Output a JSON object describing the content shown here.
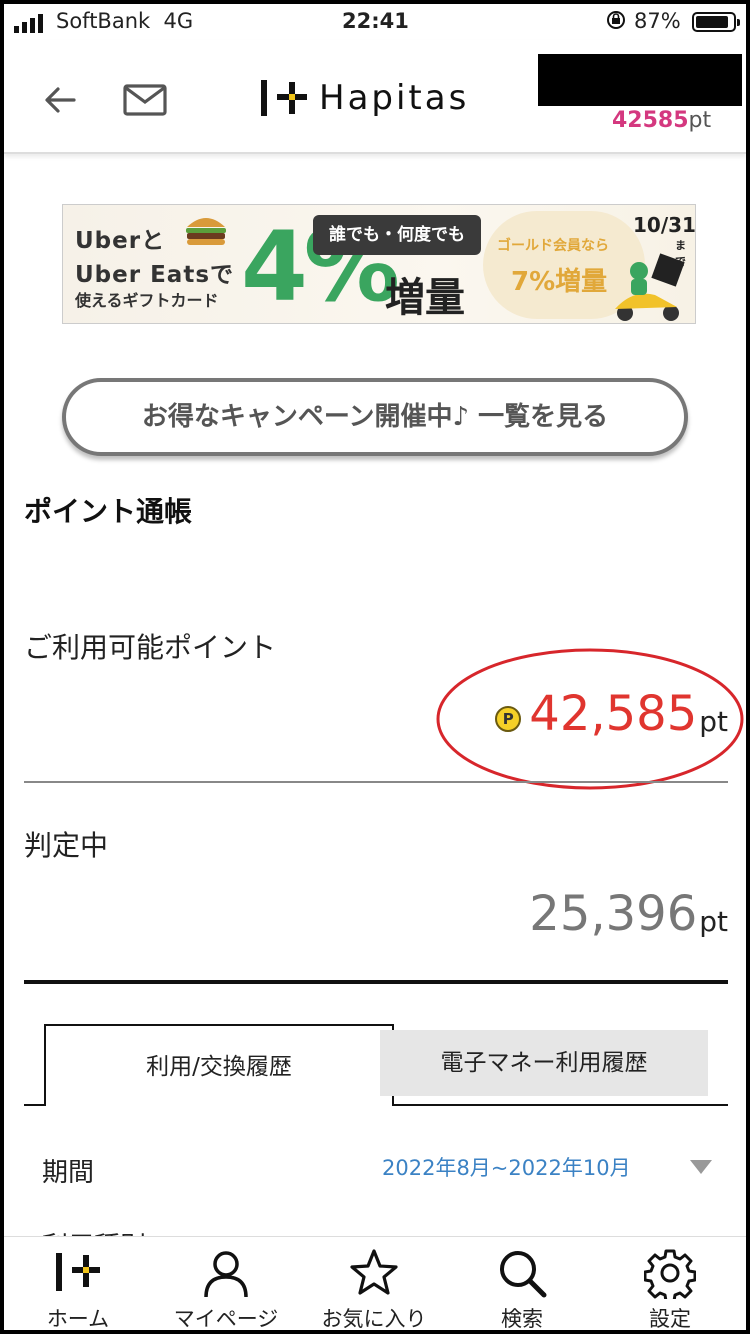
{
  "status_bar": {
    "carrier": "SoftBank",
    "network": "4G",
    "time": "22:41",
    "battery_percent": "87%"
  },
  "header": {
    "app_name": "Hapitas",
    "points_value": "42585",
    "points_unit": "pt"
  },
  "banner": {
    "line1": "Uberと",
    "line2": "Uber Eatsで",
    "line3": "使えるギフトカード",
    "badge": "誰でも・何度でも",
    "percent": "4%",
    "increase": "増量",
    "gold_note": "ゴールド会員なら",
    "gold_rate": "7%増量",
    "date": "10/31",
    "date_suffix": "まで"
  },
  "campaign_button": {
    "label": "お得なキャンペーン開催中♪ 一覧を見る"
  },
  "passbook": {
    "title": "ポイント通帳",
    "available_label": "ご利用可能ポイント",
    "coin_symbol": "P",
    "available_value": "42,585",
    "unit": "pt",
    "pending_label": "判定中",
    "pending_value": "25,396"
  },
  "tabs": [
    {
      "label": "利用/交換履歴",
      "active": true
    },
    {
      "label": "電子マネー利用履歴",
      "active": false
    }
  ],
  "filter": {
    "period_label": "期間",
    "period_value": "2022年8月~2022年10月"
  },
  "cut_off_text": "利用種別",
  "bottom_nav": [
    {
      "label": "ホーム",
      "icon": "home-logo-icon"
    },
    {
      "label": "マイページ",
      "icon": "person-icon"
    },
    {
      "label": "お気に入り",
      "icon": "star-icon"
    },
    {
      "label": "検索",
      "icon": "search-icon"
    },
    {
      "label": "設定",
      "icon": "gear-icon"
    }
  ],
  "colors": {
    "header_points": "#d4387f",
    "available_points": "#e0352f",
    "pending_points": "#777777",
    "period_link": "#3b82c4",
    "annotation_ellipse": "#d7262b"
  }
}
